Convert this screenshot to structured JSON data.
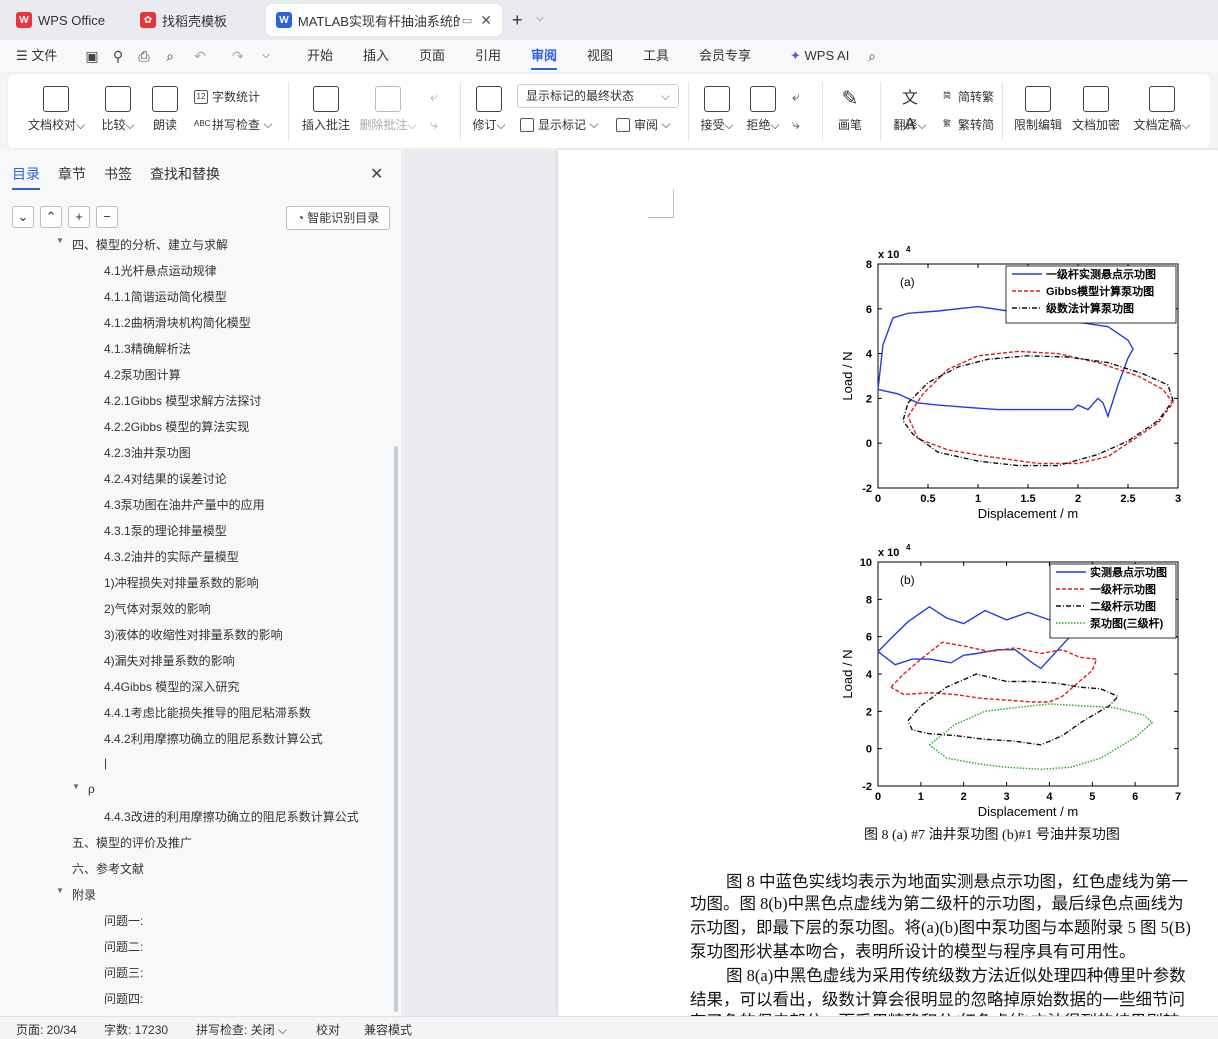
{
  "tabs": [
    {
      "label": "WPS Office",
      "icon": "wps-logo-icon"
    },
    {
      "label": "找稻壳模板",
      "icon": "docer-icon"
    },
    {
      "label": "MATLAB实现有杆抽油系统的",
      "icon": "word-doc-icon"
    }
  ],
  "menu": {
    "file": "文件",
    "items": [
      "开始",
      "插入",
      "页面",
      "引用",
      "审阅",
      "视图",
      "工具",
      "会员专享"
    ],
    "active": "审阅",
    "wps_ai": "WPS AI"
  },
  "ribbon": {
    "doc_check": "文档校对",
    "compare": "比较",
    "read_aloud": "朗读",
    "word_count": "字数统计",
    "spell_check": "拼写检查",
    "insert_comment": "插入批注",
    "delete_comment": "删除批注",
    "revise": "修订",
    "markup_state": "显示标记的最终状态",
    "show_markup": "显示标记",
    "review_pane": "审阅",
    "accept": "接受",
    "reject": "拒绝",
    "pen": "画笔",
    "translate": "翻译",
    "to_traditional": "简转繁",
    "to_simplified": "繁转简",
    "restrict_edit": "限制编辑",
    "encrypt": "文档加密",
    "finalize": "文档定稿"
  },
  "sidebar": {
    "tabs": [
      "目录",
      "章节",
      "书签",
      "查找和替换"
    ],
    "smart_toc": "智能识别目录",
    "toc": [
      {
        "text": "四、模型的分析、建立与求解",
        "level": 1,
        "expanded": true
      },
      {
        "text": "4.1光杆悬点运动规律",
        "level": 3
      },
      {
        "text": "4.1.1简谐运动简化模型",
        "level": 3
      },
      {
        "text": "4.1.2曲柄滑块机构简化模型",
        "level": 3
      },
      {
        "text": "4.1.3精确解析法",
        "level": 3
      },
      {
        "text": "4.2泵功图计算",
        "level": 3
      },
      {
        "text": "4.2.1Gibbs 模型求解方法探讨",
        "level": 3
      },
      {
        "text": "4.2.2Gibbs 模型的算法实现",
        "level": 3
      },
      {
        "text": "4.2.3油井泵功图",
        "level": 3
      },
      {
        "text": "4.2.4对结果的误差讨论",
        "level": 3
      },
      {
        "text": "4.3泵功图在油井产量中的应用",
        "level": 3
      },
      {
        "text": "4.3.1泵的理论排量模型",
        "level": 3
      },
      {
        "text": "4.3.2油井的实际产量模型",
        "level": 3
      },
      {
        "text": "1)冲程损失对排量系数的影响",
        "level": 3
      },
      {
        "text": "2)气体对泵效的影响",
        "level": 3
      },
      {
        "text": "3)液体的收缩性对排量系数的影响",
        "level": 3
      },
      {
        "text": "4)漏失对排量系数的影响",
        "level": 3
      },
      {
        "text": "4.4Gibbs 模型的深入研究",
        "level": 3
      },
      {
        "text": "4.4.1考虑比能损失推导的阻尼粘滞系数",
        "level": 3
      },
      {
        "text": "4.4.2利用摩擦功确立的阻尼系数计算公式",
        "level": 3
      },
      {
        "text": "|",
        "level": 3
      },
      {
        "text": "ρ",
        "level": 2,
        "expanded": true
      },
      {
        "text": "4.4.3改进的利用摩擦功确立的阻尼系数计算公式",
        "level": 3
      },
      {
        "text": "五、模型的评价及推广",
        "level": 1
      },
      {
        "text": "六、参考文献",
        "level": 1
      },
      {
        "text": "附录",
        "level": 1,
        "expanded": true
      },
      {
        "text": "问题一:",
        "level": 3
      },
      {
        "text": "问题二:",
        "level": 3
      },
      {
        "text": "问题三:",
        "level": 3
      },
      {
        "text": "问题四:",
        "level": 3
      }
    ]
  },
  "figure": {
    "caption": "图 8 (a) #7 油井泵功图 (b)#1 号油井泵功图"
  },
  "chart_data": [
    {
      "type": "line",
      "panel_label": "(a)",
      "xlabel": "Displacement / m",
      "ylabel": "Load / N",
      "multiplier": "x 10",
      "multiplier_exp": "4",
      "xlim": [
        0,
        3
      ],
      "ylim": [
        -2,
        8
      ],
      "xticks": [
        "0",
        "0.5",
        "1",
        "1.5",
        "2",
        "2.5",
        "3"
      ],
      "yticks": [
        "-2",
        "0",
        "2",
        "4",
        "6",
        "8"
      ],
      "legend_position": "top-right",
      "series": [
        {
          "name": "一级杆实测悬点示功图",
          "color": "#1f3fe0",
          "dash": "solid",
          "points": [
            [
              0,
              2.4
            ],
            [
              0.05,
              4.4
            ],
            [
              0.15,
              5.6
            ],
            [
              0.3,
              5.8
            ],
            [
              0.6,
              5.9
            ],
            [
              1.0,
              6.1
            ],
            [
              1.3,
              5.9
            ],
            [
              1.6,
              5.7
            ],
            [
              2.0,
              5.4
            ],
            [
              2.3,
              5.2
            ],
            [
              2.5,
              4.6
            ],
            [
              2.55,
              4.2
            ],
            [
              2.5,
              3.8
            ],
            [
              2.4,
              2.6
            ],
            [
              2.3,
              1.2
            ],
            [
              2.25,
              1.8
            ],
            [
              2.2,
              2.0
            ],
            [
              2.1,
              1.5
            ],
            [
              2.0,
              1.7
            ],
            [
              1.95,
              1.5
            ],
            [
              1.8,
              1.5
            ],
            [
              1.5,
              1.5
            ],
            [
              1.2,
              1.5
            ],
            [
              0.9,
              1.6
            ],
            [
              0.6,
              1.7
            ],
            [
              0.4,
              1.8
            ],
            [
              0.2,
              2.2
            ],
            [
              0,
              2.4
            ]
          ]
        },
        {
          "name": "Gibbs模型计算泵功图",
          "color": "#e02020",
          "dash": "4,2",
          "points": [
            [
              0.3,
              1.2
            ],
            [
              0.45,
              2.2
            ],
            [
              0.7,
              3.3
            ],
            [
              1.0,
              3.9
            ],
            [
              1.4,
              4.1
            ],
            [
              1.8,
              4.0
            ],
            [
              2.2,
              3.6
            ],
            [
              2.6,
              3.0
            ],
            [
              2.85,
              2.4
            ],
            [
              2.95,
              1.8
            ],
            [
              2.8,
              0.9
            ],
            [
              2.5,
              0.0
            ],
            [
              2.3,
              -0.6
            ],
            [
              2.0,
              -0.9
            ],
            [
              1.6,
              -0.9
            ],
            [
              1.1,
              -0.6
            ],
            [
              0.7,
              -0.3
            ],
            [
              0.4,
              0.2
            ],
            [
              0.3,
              1.2
            ]
          ]
        },
        {
          "name": "级数法计算泵功图",
          "color": "#111111",
          "dash": "5,2,1,2",
          "points": [
            [
              0.3,
              1.8
            ],
            [
              0.5,
              2.7
            ],
            [
              0.8,
              3.4
            ],
            [
              1.1,
              3.75
            ],
            [
              1.5,
              3.9
            ],
            [
              1.9,
              3.85
            ],
            [
              2.3,
              3.6
            ],
            [
              2.65,
              3.1
            ],
            [
              2.9,
              2.6
            ],
            [
              2.95,
              1.9
            ],
            [
              2.8,
              1.0
            ],
            [
              2.5,
              0.1
            ],
            [
              2.2,
              -0.5
            ],
            [
              1.8,
              -1.0
            ],
            [
              1.4,
              -1.0
            ],
            [
              1.0,
              -0.8
            ],
            [
              0.6,
              -0.4
            ],
            [
              0.35,
              0.4
            ],
            [
              0.25,
              1.0
            ],
            [
              0.3,
              1.8
            ]
          ]
        }
      ]
    },
    {
      "type": "line",
      "panel_label": "(b)",
      "xlabel": "Displacement / m",
      "ylabel": "Load / N",
      "multiplier": "x 10",
      "multiplier_exp": "4",
      "xlim": [
        0,
        7
      ],
      "ylim": [
        -2,
        10
      ],
      "xticks": [
        "0",
        "1",
        "2",
        "3",
        "4",
        "5",
        "6",
        "7"
      ],
      "yticks": [
        "-2",
        "0",
        "2",
        "4",
        "6",
        "8",
        "10"
      ],
      "legend_position": "top-right",
      "series": [
        {
          "name": "实测悬点示功图",
          "color": "#1f3fe0",
          "dash": "solid",
          "points": [
            [
              0,
              5.2
            ],
            [
              0.3,
              5.9
            ],
            [
              0.7,
              6.8
            ],
            [
              1.2,
              7.6
            ],
            [
              1.6,
              7.0
            ],
            [
              2.0,
              6.7
            ],
            [
              2.5,
              7.4
            ],
            [
              3.0,
              6.9
            ],
            [
              3.5,
              7.3
            ],
            [
              4.0,
              6.9
            ],
            [
              4.5,
              6.5
            ],
            [
              4.8,
              6.7
            ],
            [
              4.6,
              6.3
            ],
            [
              4.2,
              5.3
            ],
            [
              3.8,
              4.3
            ],
            [
              3.6,
              4.6
            ],
            [
              3.2,
              5.3
            ],
            [
              2.8,
              5.3
            ],
            [
              2.3,
              5.1
            ],
            [
              2.0,
              5.0
            ],
            [
              1.7,
              4.6
            ],
            [
              1.2,
              4.8
            ],
            [
              0.8,
              4.8
            ],
            [
              0.4,
              4.5
            ],
            [
              0,
              5.2
            ]
          ]
        },
        {
          "name": "一级杆示功图",
          "color": "#e02020",
          "dash": "4,2",
          "points": [
            [
              0.3,
              3.3
            ],
            [
              0.6,
              4.0
            ],
            [
              1.0,
              4.8
            ],
            [
              1.5,
              5.7
            ],
            [
              2.0,
              5.5
            ],
            [
              2.6,
              5.2
            ],
            [
              3.2,
              5.4
            ],
            [
              3.8,
              5.1
            ],
            [
              4.3,
              5.3
            ],
            [
              4.7,
              4.9
            ],
            [
              5.1,
              4.8
            ],
            [
              5.0,
              4.2
            ],
            [
              4.7,
              3.6
            ],
            [
              4.3,
              2.8
            ],
            [
              4.0,
              2.5
            ],
            [
              3.6,
              2.5
            ],
            [
              3.0,
              2.6
            ],
            [
              2.4,
              2.7
            ],
            [
              1.8,
              2.9
            ],
            [
              1.2,
              3.0
            ],
            [
              0.6,
              2.9
            ],
            [
              0.3,
              3.3
            ]
          ]
        },
        {
          "name": "二级杆示功图",
          "color": "#111111",
          "dash": "5,2,1,2",
          "points": [
            [
              0.7,
              1.5
            ],
            [
              1.0,
              2.3
            ],
            [
              1.6,
              3.3
            ],
            [
              2.3,
              4.0
            ],
            [
              3.0,
              3.6
            ],
            [
              3.6,
              3.6
            ],
            [
              4.2,
              3.5
            ],
            [
              4.7,
              3.3
            ],
            [
              5.2,
              3.2
            ],
            [
              5.6,
              2.8
            ],
            [
              5.4,
              2.3
            ],
            [
              4.8,
              1.5
            ],
            [
              4.3,
              0.7
            ],
            [
              3.8,
              0.2
            ],
            [
              3.2,
              0.4
            ],
            [
              2.5,
              0.5
            ],
            [
              1.8,
              0.7
            ],
            [
              1.2,
              0.8
            ],
            [
              0.8,
              1.0
            ],
            [
              0.7,
              1.5
            ]
          ]
        },
        {
          "name": "泵功图(三级杆)",
          "color": "#18b018",
          "dash": "1.5,1.5",
          "points": [
            [
              1.2,
              0.2
            ],
            [
              1.8,
              1.3
            ],
            [
              2.5,
              2.0
            ],
            [
              3.2,
              2.2
            ],
            [
              4.0,
              2.4
            ],
            [
              4.7,
              2.3
            ],
            [
              5.5,
              2.2
            ],
            [
              6.2,
              1.8
            ],
            [
              6.4,
              1.4
            ],
            [
              6.0,
              0.6
            ],
            [
              5.2,
              -0.5
            ],
            [
              4.5,
              -1.0
            ],
            [
              3.8,
              -1.1
            ],
            [
              3.0,
              -1.0
            ],
            [
              2.3,
              -0.8
            ],
            [
              1.6,
              -0.5
            ],
            [
              1.2,
              0.2
            ]
          ]
        }
      ]
    }
  ],
  "body_paragraphs": [
    "图 8 中蓝色实线均表示为地面实测悬点示功图，红色虚线为第一",
    "功图。图 8(b)中黑色点虚线为第二级杆的示功图，最后绿色点画线为",
    "示功图，即最下层的泵功图。将(a)(b)图中泵功图与本题附录 5 图 5(B)",
    "泵功图形状基本吻合，表明所设计的模型与程序具有可用性。",
    "图 8(a)中黑色虚线为采用传统级数方法近似处理四种傅里叶参数",
    "结果，可以看出，级数计算会很明显的忽略掉原始数据的一些细节问",
    "有了色的保皮部分，而采用精确积分(红色虚线)方法得到的结果则较"
  ],
  "status": {
    "page": "页面: 20/34",
    "words": "字数: 17230",
    "spell": "拼写检查: 关闭",
    "proof": "校对",
    "compat": "兼容模式"
  },
  "colors": {
    "accent": "#2b63d9",
    "wps_red": "#e8353a"
  }
}
